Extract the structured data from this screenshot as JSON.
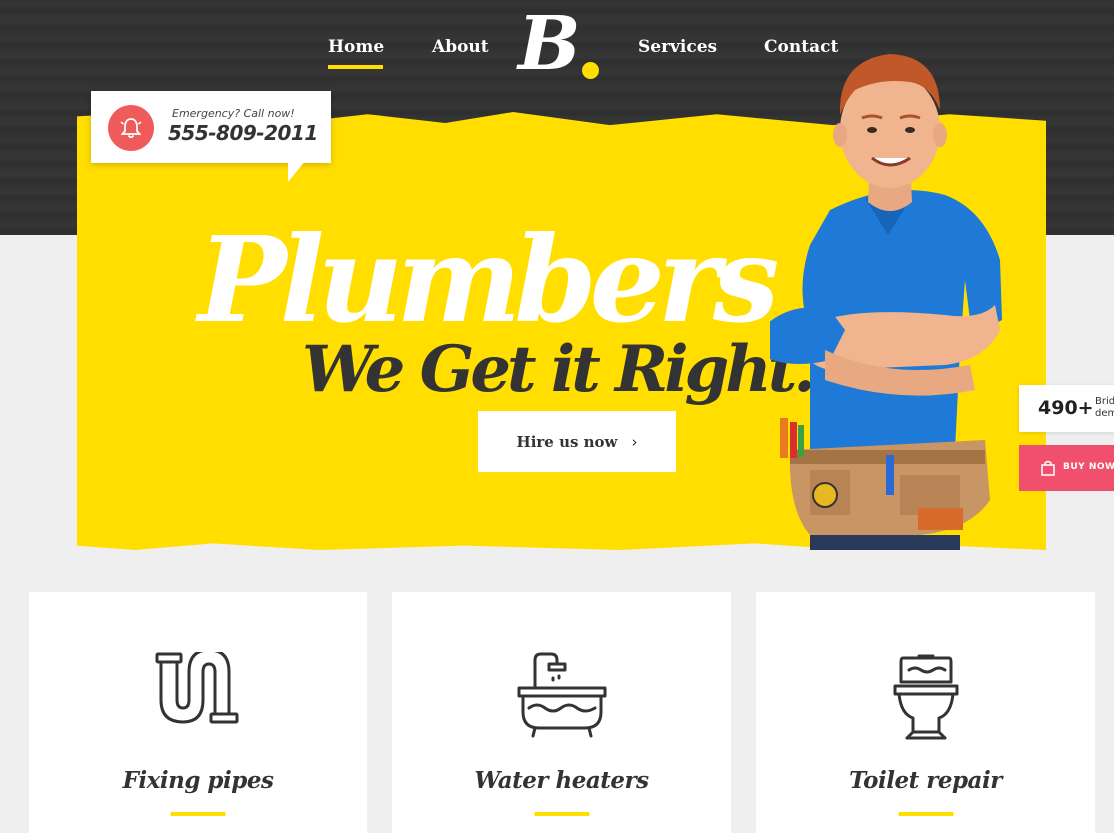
{
  "nav": {
    "items": [
      {
        "label": "Home",
        "active": true
      },
      {
        "label": "About"
      },
      {
        "label": "Services"
      },
      {
        "label": "Contact"
      }
    ],
    "logo": "B",
    "accent_color": "#ffde00"
  },
  "emergency": {
    "label": "Emergency? Call now!",
    "phone": "555-809-2011",
    "icon": "bell-icon",
    "icon_color": "#ef5a5a"
  },
  "hero": {
    "headline": "Plumbers",
    "subheadline": "We Get it Right.",
    "cta_label": "Hire us now",
    "cta_icon": "chevron-right-icon",
    "background_color": "#ffde00"
  },
  "sidebar": {
    "count": "490+",
    "count_text_line1": "Brid",
    "count_text_line2": "dem",
    "buy_label": "BUY NOW",
    "buy_icon": "shopping-bag-icon",
    "buy_color": "#f0506e"
  },
  "services": [
    {
      "title": "Fixing pipes",
      "icon": "pipe-icon"
    },
    {
      "title": "Water heaters",
      "icon": "bathtub-icon"
    },
    {
      "title": "Toilet repair",
      "icon": "toilet-icon"
    }
  ]
}
